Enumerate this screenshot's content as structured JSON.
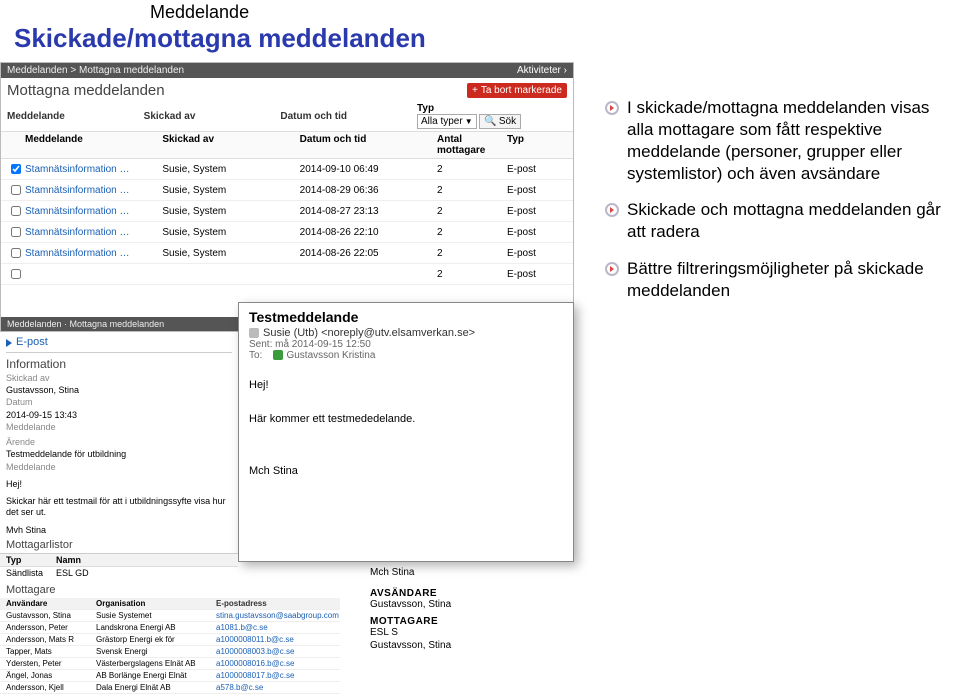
{
  "page_header": {
    "small": "Meddelande",
    "big": "Skickade/mottagna meddelanden"
  },
  "app": {
    "breadcrumb": "Meddelanden > Mottagna meddelanden",
    "activities_label": "Aktiviteter",
    "page_title": "Mottagna meddelanden",
    "delete_button": "Ta bort markerade",
    "toolbar": {
      "col_meddelande": "Meddelande",
      "col_skickad_av": "Skickad av",
      "col_datum": "Datum och tid",
      "col_typ": "Typ",
      "select_value": "Alla typer",
      "search_label": "Sök"
    },
    "table_headers": {
      "h1": "Meddelande",
      "h2": "Skickad av",
      "h3": "Datum och tid",
      "h4": "Antal mottagare",
      "h5": "Typ"
    },
    "rows": [
      {
        "msg": "Stamnätsinformation …",
        "by": "Susie, System",
        "dt": "2014-09-10 06:49",
        "n": "2",
        "typ": "E-post",
        "checked": true
      },
      {
        "msg": "Stamnätsinformation …",
        "by": "Susie, System",
        "dt": "2014-08-29 06:36",
        "n": "2",
        "typ": "E-post",
        "checked": false
      },
      {
        "msg": "Stamnätsinformation …",
        "by": "Susie, System",
        "dt": "2014-08-27 23:13",
        "n": "2",
        "typ": "E-post",
        "checked": false
      },
      {
        "msg": "Stamnätsinformation …",
        "by": "Susie, System",
        "dt": "2014-08-26 22:10",
        "n": "2",
        "typ": "E-post",
        "checked": false
      },
      {
        "msg": "Stamnätsinformation …",
        "by": "Susie, System",
        "dt": "2014-08-26 22:05",
        "n": "2",
        "typ": "E-post",
        "checked": false
      },
      {
        "msg": "",
        "by": "",
        "dt": "",
        "n": "2",
        "typ": "E-post",
        "checked": false
      }
    ],
    "sub_breadcrumb": "Meddelanden · Mottagna meddelanden"
  },
  "info_panel": {
    "epost": "E-post",
    "title": "Information",
    "k_from": "Skickad av",
    "v_from": "Gustavsson, Stina",
    "k_date": "Datum",
    "v_date": "2014-09-15 13:43",
    "k_msg": "Meddelande",
    "k_sub": "Ärende",
    "v_sub": "Testmeddelande för utbildning",
    "k_body": "Meddelande",
    "body1": "Hej!",
    "body2": "Skickar här ett testmail för att i utbildningssyfte visa hur det ser ut.",
    "body3": "Mvh Stina"
  },
  "popup": {
    "subject": "Testmeddelande",
    "from": "Susie (Utb) <noreply@utv.elsamverkan.se>",
    "sent_label": "Sent:",
    "sent_value": "må 2014-09-15 12:50",
    "to_label": "To:",
    "to_value": "Gustavsson Kristina",
    "body_hej": "Hej!",
    "body_text": "Här kommer ett testmededelande.",
    "sign": "Mch Stina"
  },
  "mottagarlistor": {
    "title": "Mottagarlistor",
    "th_typ": "Typ",
    "th_namn": "Namn",
    "row_typ": "Sändlista",
    "row_namn": "ESL GD"
  },
  "mottagare_table": {
    "title": "Mottagare",
    "th_user": "Användare",
    "th_org": "Organisation",
    "th_email": "E-postadress",
    "rows": [
      {
        "u": "Gustavsson, Stina",
        "o": "Susie Systemet",
        "e": "stina.gustavsson@saabgroup.com"
      },
      {
        "u": "Andersson, Peter",
        "o": "Landskrona Energi AB",
        "e": "a1081.b@c.se"
      },
      {
        "u": "Andersson, Mats R",
        "o": "Grästorp Energi ek för",
        "e": "a1000008011.b@c.se"
      },
      {
        "u": "Tapper, Mats",
        "o": "Svensk Energi",
        "e": "a1000008003.b@c.se"
      },
      {
        "u": "Ydersten, Peter",
        "o": "Västerbergslagens Elnät AB",
        "e": "a1000008016.b@c.se"
      },
      {
        "u": "Ängel, Jonas",
        "o": "AB Borlänge Energi Elnät",
        "e": "a1000008017.b@c.se"
      },
      {
        "u": "Andersson, Kjell",
        "o": "Dala Energi Elnät AB",
        "e": "a578.b@c.se"
      }
    ]
  },
  "senders": {
    "sign": "Mch Stina",
    "avs_title": "AVSÄNDARE",
    "avs_value": "Gustavsson, Stina",
    "mott_title": "MOTTAGARE",
    "mott_v1": "ESL S",
    "mott_v2": "Gustavsson, Stina"
  },
  "bullets": {
    "b1": "I skickade/mottagna meddelanden visas alla mottagare som fått respektive meddelande (personer, grupper eller systemlistor) och även avsändare",
    "b2": "Skickade och mottagna meddelanden går att radera",
    "b3": "Bättre filtreringsmöjligheter på skickade meddelanden"
  }
}
